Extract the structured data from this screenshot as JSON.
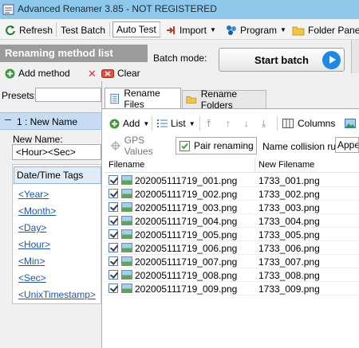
{
  "window": {
    "title": "Advanced Renamer 3.85 - NOT REGISTERED"
  },
  "toolbar": {
    "refresh": "Refresh",
    "test_batch": "Test Batch",
    "auto_test": "Auto Test",
    "import": "Import",
    "program": "Program",
    "folder_panel": "Folder Panel"
  },
  "left": {
    "header": "Renaming method list",
    "add_method": "Add method",
    "clear": "Clear",
    "presets_label": "Presets:",
    "method_item": "1 : New Name",
    "new_name_label": "New Name:",
    "new_name_value": "<Hour><Sec>",
    "tags_tab": "Date/Time Tags",
    "tags": [
      "<Year>",
      "<Month>",
      "<Day>",
      "<Hour>",
      "<Min>",
      "<Sec>",
      "<UnixTimestamp>"
    ]
  },
  "batch": {
    "mode_label": "Batch mode:",
    "start_label": "Start batch"
  },
  "tabs": {
    "rename_files": "Rename Files",
    "rename_folders": "Rename Folders"
  },
  "filetoolbar": {
    "add": "Add",
    "list": "List",
    "columns": "Columns"
  },
  "subtabs": {
    "gps": "GPS Values",
    "pair": "Pair renaming",
    "collision_label": "Name collision rule:",
    "collision_value": "Appen"
  },
  "table": {
    "headers": [
      "Filename",
      "New Filename"
    ],
    "rows": [
      [
        "202005111719_001.png",
        "1733_001.png"
      ],
      [
        "202005111719_002.png",
        "1733_002.png"
      ],
      [
        "202005111719_003.png",
        "1733_003.png"
      ],
      [
        "202005111719_004.png",
        "1733_004.png"
      ],
      [
        "202005111719_005.png",
        "1733_005.png"
      ],
      [
        "202005111719_006.png",
        "1733_006.png"
      ],
      [
        "202005111719_007.png",
        "1733_007.png"
      ],
      [
        "202005111719_008.png",
        "1733_008.png"
      ],
      [
        "202005111719_009.png",
        "1733_009.png"
      ]
    ]
  },
  "colors": {
    "titlebar": "#8ec9ec",
    "header_gray": "#9b9b9b",
    "link_blue": "#1a55b5",
    "selected_item": "#c5dcf3"
  }
}
